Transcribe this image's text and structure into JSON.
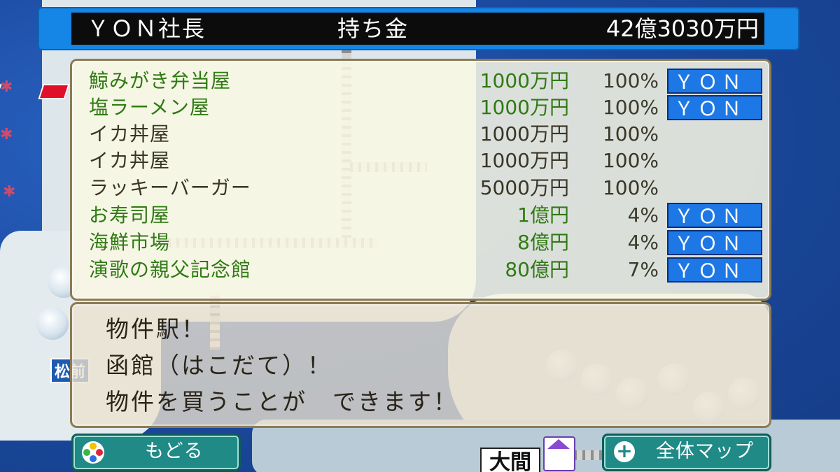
{
  "header": {
    "president_name": "ＹＯＮ社長",
    "money_label": "持ち金",
    "money_value": "42億3030万円"
  },
  "properties": [
    {
      "name": "鯨みがき弁当屋",
      "price": "1000万円",
      "percent": "100%",
      "owner": "ＹＯＮ",
      "owned": true
    },
    {
      "name": "塩ラーメン屋",
      "price": "1000万円",
      "percent": "100%",
      "owner": "ＹＯＮ",
      "owned": true
    },
    {
      "name": "イカ丼屋",
      "price": "1000万円",
      "percent": "100%",
      "owner": "",
      "owned": false
    },
    {
      "name": "イカ丼屋",
      "price": "1000万円",
      "percent": "100%",
      "owner": "",
      "owned": false
    },
    {
      "name": "ラッキーバーガー",
      "price": "5000万円",
      "percent": "100%",
      "owner": "",
      "owned": false
    },
    {
      "name": "お寿司屋",
      "price": "1億円",
      "percent": "4%",
      "owner": "ＹＯＮ",
      "owned": true
    },
    {
      "name": "海鮮市場",
      "price": "8億円",
      "percent": "4%",
      "owner": "ＹＯＮ",
      "owned": true
    },
    {
      "name": "演歌の親父記念館",
      "price": "80億円",
      "percent": "7%",
      "owner": "ＹＯＮ",
      "owned": true
    }
  ],
  "message": {
    "line1": "物件駅！",
    "line2": "函館（はこだて）！",
    "line3": "物件を買うことが　できます！"
  },
  "buttons": {
    "back_label": "もどる",
    "map_label": "全体マップ"
  },
  "map": {
    "town_label": "松前",
    "station_label": "大間"
  },
  "colors": {
    "topbar": "#1585e6",
    "owner_tag": "#1d78e6",
    "owned_text": "#2f7a13",
    "button": "#1f8a86"
  }
}
